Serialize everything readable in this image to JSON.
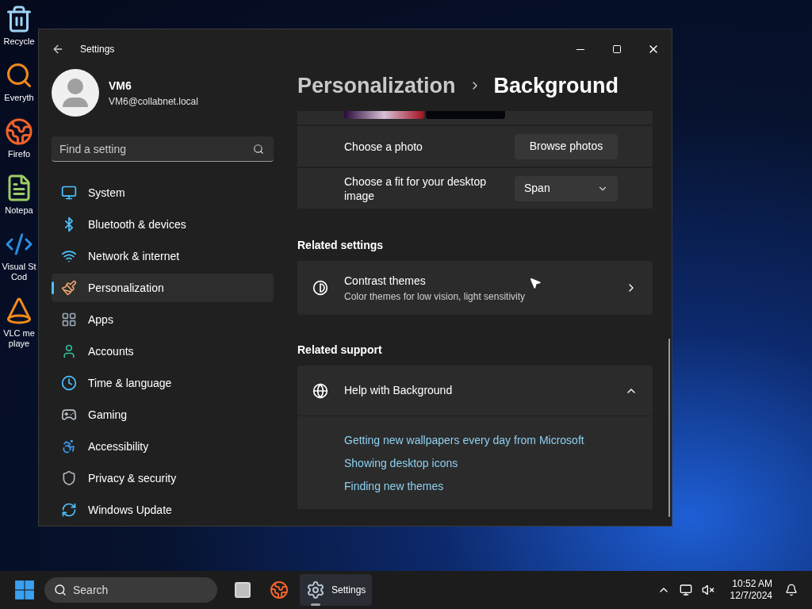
{
  "desktop_icons": [
    {
      "lines": [
        "Recycle"
      ]
    },
    {
      "lines": [
        "Everyth"
      ]
    },
    {
      "lines": [
        "Firefo"
      ]
    },
    {
      "lines": [
        "Notepa"
      ]
    },
    {
      "lines": [
        "Visual St",
        "Cod"
      ]
    },
    {
      "lines": [
        "VLC me",
        "playe"
      ]
    }
  ],
  "window": {
    "title": "Settings"
  },
  "profile": {
    "name": "VM6",
    "email": "VM6@collabnet.local"
  },
  "search": {
    "placeholder": "Find a setting"
  },
  "nav": [
    {
      "label": "System",
      "selected": false
    },
    {
      "label": "Bluetooth & devices",
      "selected": false
    },
    {
      "label": "Network & internet",
      "selected": false
    },
    {
      "label": "Personalization",
      "selected": true
    },
    {
      "label": "Apps",
      "selected": false
    },
    {
      "label": "Accounts",
      "selected": false
    },
    {
      "label": "Time & language",
      "selected": false
    },
    {
      "label": "Gaming",
      "selected": false
    },
    {
      "label": "Accessibility",
      "selected": false
    },
    {
      "label": "Privacy & security",
      "selected": false
    },
    {
      "label": "Windows Update",
      "selected": false
    }
  ],
  "breadcrumb": [
    "Personalization",
    "Background"
  ],
  "background_rows": [
    {
      "kind": "button",
      "label": "Choose a photo",
      "control": "Browse photos"
    },
    {
      "kind": "dropdown",
      "label": "Choose a fit for your desktop image",
      "control": "Span"
    }
  ],
  "related_settings": {
    "heading": "Related settings",
    "items": [
      {
        "title": "Contrast themes",
        "subtitle": "Color themes for low vision, light sensitivity"
      }
    ]
  },
  "related_support": {
    "heading": "Related support",
    "title": "Help with Background",
    "expanded": true,
    "links": [
      "Getting new wallpapers every day from Microsoft",
      "Showing desktop icons",
      "Finding new themes"
    ]
  },
  "taskbar": {
    "search_placeholder": "Search",
    "apps": [
      {
        "kind": "task-view",
        "selected": false
      },
      {
        "kind": "browser",
        "selected": false
      },
      {
        "kind": "gear",
        "label": "Settings",
        "selected": true
      }
    ],
    "time": "10:52 AM",
    "date": "12/7/2024"
  }
}
